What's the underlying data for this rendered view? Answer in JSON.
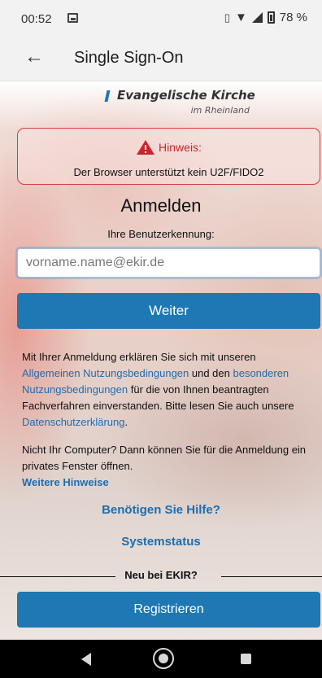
{
  "status_bar": {
    "time": "00:52",
    "battery": "78 %",
    "icons": [
      "image-icon",
      "vibrate-icon",
      "wifi-icon",
      "signal-icon",
      "battery-icon"
    ]
  },
  "app_bar": {
    "back_icon": "arrow-left-icon",
    "title": "Single Sign-On"
  },
  "logo": {
    "name": "Evangelische Kirche",
    "subtitle": "im Rheinland",
    "accent_color": "#1f77b8"
  },
  "notice": {
    "icon": "warning-icon",
    "title": "Hinweis:",
    "message": "Der Browser unterstützt kein U2F/FIDO2",
    "border_color": "#d83b3b"
  },
  "login": {
    "title": "Anmelden",
    "user_label": "Ihre Benutzerkennung:",
    "user_placeholder": "vorname.name@ekir.de",
    "user_value": "",
    "next_button": "Weiter"
  },
  "terms": {
    "part1": "Mit Ihrer Anmeldung erklären Sie sich mit unseren ",
    "link_general": "Allgemeinen Nutzungsbedingungen",
    "part2": " und den ",
    "link_special": "besonderen Nutzungsbedingungen",
    "part3": " für die von Ihnen beantragten Fachverfahren einverstanden. Bitte lesen Sie auch unsere ",
    "link_privacy": "Datenschutzerklärung",
    "part4": "."
  },
  "private_note": {
    "text": "Nicht Ihr Computer? Dann können Sie für die Anmeldung ein privates Fenster öffnen.",
    "link_more": "Weitere Hinweise"
  },
  "links": {
    "help": "Benötigen Sie Hilfe?",
    "system_status": "Systemstatus"
  },
  "register": {
    "divider_label": "Neu bei EKIR?",
    "button": "Registrieren"
  },
  "colors": {
    "primary_button": "#1d78b3",
    "link": "#1d6db0",
    "notice_title": "#c8252c"
  },
  "nav_bar": {
    "icons": [
      "nav-back-icon",
      "nav-home-icon",
      "nav-recents-icon"
    ]
  }
}
